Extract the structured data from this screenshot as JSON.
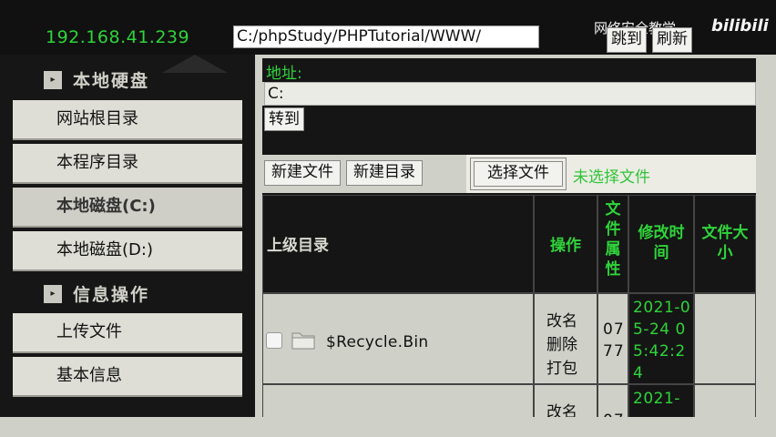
{
  "topbar": {
    "ip": "192.168.41.239",
    "path_value": "C:/phpStudy/PHPTutorial/WWW/",
    "watermark": "网络安全教学",
    "logo": "bilibili",
    "jump_label": "跳到",
    "refresh_label": "刷新"
  },
  "sidebar": {
    "section1": "本地硬盘",
    "items1": [
      "网站根目录",
      "本程序目录",
      "本地磁盘(C:)",
      "本地磁盘(D:)"
    ],
    "section2": "信息操作",
    "items2": [
      "上传文件",
      "基本信息"
    ]
  },
  "main": {
    "address_label": "地址:",
    "address_value": "C:",
    "goto_label": "转到",
    "new_file_label": "新建文件",
    "new_dir_label": "新建目录",
    "choose_file_label": "选择文件",
    "no_file_text": "未选择文件"
  },
  "table": {
    "headers": {
      "parent": "上级目录",
      "ops": "操作",
      "attr": "文件属性",
      "mtime": "修改时间",
      "size": "文件大小"
    },
    "rows": [
      {
        "name": "$Recycle.Bin",
        "ops": [
          "改名",
          "删除",
          "打包"
        ],
        "attr": "0777",
        "mtime": "2021-05-24 05:42:24",
        "size": ""
      },
      {
        "name": "",
        "ops": [
          "改名"
        ],
        "attr": "07",
        "mtime": "2021-",
        "size": ""
      }
    ]
  },
  "colors": {
    "accent_green": "#2fd43a",
    "dark_bg": "#151515",
    "panel_bg": "#cfd0c8"
  }
}
